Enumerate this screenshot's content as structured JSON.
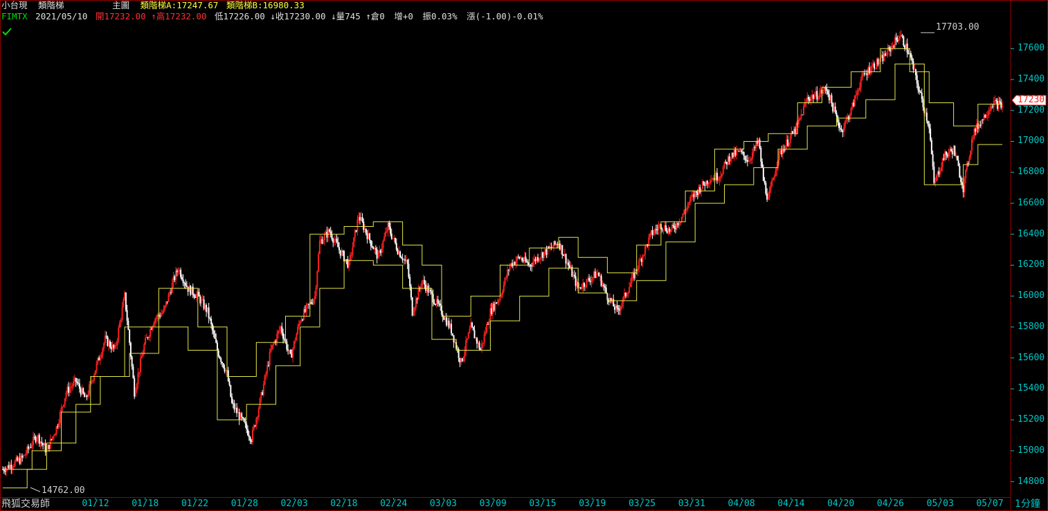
{
  "header": {
    "symbol_name": "小台現",
    "indicator_name": "類階梯",
    "pane_label": "主圖",
    "ladder_a_label": "類階梯A:",
    "ladder_a_value": "17247.67",
    "ladder_b_label": "類階梯B:",
    "ladder_b_value": "16980.33",
    "ticker": "FIMTX",
    "date": "2021/05/10",
    "open_label": "開",
    "open_value": "17232.00",
    "high_label": "高",
    "high_value": "17232.00",
    "low_label": "低",
    "low_value": "17226.00",
    "close_label": "收",
    "close_value": "17230.00",
    "volume_label": "量",
    "volume_value": "745",
    "oi_label": "倉",
    "oi_value": "0",
    "oi_change_label": "增",
    "oi_change_value": "+0",
    "amplitude_label": "振",
    "amplitude_value": "0.03%",
    "change_label": "漲",
    "change_value": "(-1.00)-0.01%",
    "arrow_up": "↑",
    "arrow_down": "↓"
  },
  "footer": {
    "brand": "飛狐交易師",
    "period": "1分鐘"
  },
  "colors": {
    "up": "#ff2020",
    "down": "#ffffff",
    "ladder": "#e8e84a",
    "axis_text": "#00c8c8",
    "border": "#9a0000",
    "header_yellow": "#ffff40",
    "header_green": "#00e000",
    "header_white": "#e0e0e0"
  },
  "chart_data": {
    "type": "candlestick",
    "x_ticks": [
      "01/12",
      "01/18",
      "01/22",
      "01/28",
      "02/03",
      "02/18",
      "02/24",
      "03/03",
      "03/09",
      "03/15",
      "03/19",
      "03/25",
      "03/31",
      "04/08",
      "04/14",
      "04/20",
      "04/26",
      "05/03",
      "05/07"
    ],
    "y_ticks": [
      14800,
      15000,
      15200,
      15400,
      15600,
      15800,
      16000,
      16200,
      16400,
      16600,
      16800,
      17000,
      17200,
      17400,
      17600
    ],
    "ylim": [
      14700,
      17780
    ],
    "last_price": "17230",
    "max_label": "17703.00",
    "min_label": "14762.00",
    "price_path": [
      [
        0,
        14880
      ],
      [
        4,
        14950
      ],
      [
        7,
        15100
      ],
      [
        9,
        15000
      ],
      [
        11,
        15150
      ],
      [
        13,
        15380
      ],
      [
        15,
        15450
      ],
      [
        17,
        15330
      ],
      [
        19,
        15530
      ],
      [
        21,
        15720
      ],
      [
        23,
        15650
      ],
      [
        25,
        16000
      ],
      [
        26,
        15700
      ],
      [
        27,
        15380
      ],
      [
        29,
        15680
      ],
      [
        31,
        15850
      ],
      [
        33,
        15900
      ],
      [
        35,
        16100
      ],
      [
        36,
        16180
      ],
      [
        38,
        16050
      ],
      [
        40,
        16000
      ],
      [
        42,
        15900
      ],
      [
        44,
        15650
      ],
      [
        46,
        15500
      ],
      [
        47,
        15300
      ],
      [
        49,
        15200
      ],
      [
        51,
        15080
      ],
      [
        53,
        15350
      ],
      [
        55,
        15650
      ],
      [
        57,
        15800
      ],
      [
        59,
        15600
      ],
      [
        61,
        15850
      ],
      [
        63,
        15950
      ],
      [
        64,
        16000
      ],
      [
        65,
        16350
      ],
      [
        67,
        16420
      ],
      [
        69,
        16300
      ],
      [
        71,
        16200
      ],
      [
        73,
        16520
      ],
      [
        75,
        16380
      ],
      [
        77,
        16250
      ],
      [
        79,
        16450
      ],
      [
        81,
        16300
      ],
      [
        83,
        16200
      ],
      [
        84,
        15900
      ],
      [
        86,
        16100
      ],
      [
        88,
        16000
      ],
      [
        90,
        15900
      ],
      [
        92,
        15780
      ],
      [
        94,
        15570
      ],
      [
        96,
        15800
      ],
      [
        98,
        15650
      ],
      [
        100,
        15900
      ],
      [
        102,
        16000
      ],
      [
        104,
        16200
      ],
      [
        106,
        16250
      ],
      [
        108,
        16200
      ],
      [
        110,
        16260
      ],
      [
        112,
        16300
      ],
      [
        114,
        16350
      ],
      [
        116,
        16200
      ],
      [
        118,
        16050
      ],
      [
        120,
        16100
      ],
      [
        122,
        16150
      ],
      [
        124,
        16000
      ],
      [
        126,
        15900
      ],
      [
        127,
        15960
      ],
      [
        129,
        16100
      ],
      [
        131,
        16250
      ],
      [
        133,
        16400
      ],
      [
        135,
        16460
      ],
      [
        137,
        16420
      ],
      [
        139,
        16500
      ],
      [
        141,
        16620
      ],
      [
        143,
        16700
      ],
      [
        145,
        16760
      ],
      [
        147,
        16780
      ],
      [
        149,
        16900
      ],
      [
        151,
        16930
      ],
      [
        153,
        16880
      ],
      [
        155,
        17000
      ],
      [
        156,
        16750
      ],
      [
        157,
        16620
      ],
      [
        159,
        16900
      ],
      [
        161,
        17000
      ],
      [
        163,
        17100
      ],
      [
        165,
        17280
      ],
      [
        167,
        17300
      ],
      [
        169,
        17340
      ],
      [
        171,
        17150
      ],
      [
        172,
        17070
      ],
      [
        174,
        17200
      ],
      [
        176,
        17400
      ],
      [
        178,
        17480
      ],
      [
        180,
        17520
      ],
      [
        182,
        17600
      ],
      [
        184,
        17690
      ],
      [
        186,
        17560
      ],
      [
        188,
        17320
      ],
      [
        190,
        17100
      ],
      [
        191,
        16720
      ],
      [
        193,
        16900
      ],
      [
        195,
        16950
      ],
      [
        197,
        16700
      ],
      [
        199,
        17050
      ],
      [
        201,
        17150
      ],
      [
        203,
        17250
      ],
      [
        205,
        17230
      ]
    ],
    "ladder_a": [
      [
        0,
        14880
      ],
      [
        6,
        14880
      ],
      [
        6,
        15000
      ],
      [
        12,
        15000
      ],
      [
        12,
        15250
      ],
      [
        18,
        15250
      ],
      [
        18,
        15480
      ],
      [
        25,
        15480
      ],
      [
        25,
        15800
      ],
      [
        32,
        15800
      ],
      [
        32,
        16050
      ],
      [
        40,
        16050
      ],
      [
        40,
        15800
      ],
      [
        46,
        15800
      ],
      [
        46,
        15480
      ],
      [
        52,
        15480
      ],
      [
        52,
        15700
      ],
      [
        58,
        15700
      ],
      [
        58,
        15870
      ],
      [
        63,
        15870
      ],
      [
        63,
        16400
      ],
      [
        70,
        16400
      ],
      [
        70,
        16450
      ],
      [
        76,
        16450
      ],
      [
        76,
        16480
      ],
      [
        82,
        16480
      ],
      [
        82,
        16330
      ],
      [
        86,
        16330
      ],
      [
        86,
        16200
      ],
      [
        90,
        16200
      ],
      [
        90,
        15870
      ],
      [
        96,
        15870
      ],
      [
        96,
        16000
      ],
      [
        102,
        16000
      ],
      [
        102,
        16200
      ],
      [
        108,
        16200
      ],
      [
        108,
        16310
      ],
      [
        114,
        16310
      ],
      [
        114,
        16380
      ],
      [
        118,
        16380
      ],
      [
        118,
        16250
      ],
      [
        124,
        16250
      ],
      [
        124,
        16150
      ],
      [
        130,
        16150
      ],
      [
        130,
        16330
      ],
      [
        135,
        16330
      ],
      [
        135,
        16480
      ],
      [
        140,
        16480
      ],
      [
        140,
        16680
      ],
      [
        146,
        16680
      ],
      [
        146,
        16950
      ],
      [
        152,
        16950
      ],
      [
        152,
        17000
      ],
      [
        157,
        17000
      ],
      [
        157,
        17050
      ],
      [
        163,
        17050
      ],
      [
        163,
        17250
      ],
      [
        168,
        17250
      ],
      [
        168,
        17350
      ],
      [
        174,
        17350
      ],
      [
        174,
        17450
      ],
      [
        180,
        17450
      ],
      [
        180,
        17600
      ],
      [
        186,
        17600
      ],
      [
        186,
        17450
      ],
      [
        190,
        17450
      ],
      [
        190,
        17250
      ],
      [
        195,
        17250
      ],
      [
        195,
        17100
      ],
      [
        200,
        17100
      ],
      [
        200,
        17240
      ],
      [
        205,
        17240
      ]
    ],
    "ladder_b": [
      [
        0,
        14760
      ],
      [
        5,
        14760
      ],
      [
        5,
        14880
      ],
      [
        9,
        14880
      ],
      [
        9,
        15050
      ],
      [
        15,
        15050
      ],
      [
        15,
        15300
      ],
      [
        20,
        15300
      ],
      [
        20,
        15480
      ],
      [
        26,
        15480
      ],
      [
        26,
        15630
      ],
      [
        32,
        15630
      ],
      [
        32,
        15800
      ],
      [
        38,
        15800
      ],
      [
        38,
        15650
      ],
      [
        44,
        15650
      ],
      [
        44,
        15200
      ],
      [
        50,
        15200
      ],
      [
        50,
        15300
      ],
      [
        56,
        15300
      ],
      [
        56,
        15550
      ],
      [
        61,
        15550
      ],
      [
        61,
        15800
      ],
      [
        65,
        15800
      ],
      [
        65,
        16050
      ],
      [
        70,
        16050
      ],
      [
        70,
        16230
      ],
      [
        76,
        16230
      ],
      [
        76,
        16200
      ],
      [
        82,
        16200
      ],
      [
        82,
        16050
      ],
      [
        88,
        16050
      ],
      [
        88,
        15720
      ],
      [
        93,
        15720
      ],
      [
        93,
        15650
      ],
      [
        100,
        15650
      ],
      [
        100,
        15840
      ],
      [
        106,
        15840
      ],
      [
        106,
        16000
      ],
      [
        112,
        16000
      ],
      [
        112,
        16180
      ],
      [
        118,
        16180
      ],
      [
        118,
        16020
      ],
      [
        124,
        16020
      ],
      [
        124,
        15970
      ],
      [
        130,
        15970
      ],
      [
        130,
        16100
      ],
      [
        136,
        16100
      ],
      [
        136,
        16350
      ],
      [
        142,
        16350
      ],
      [
        142,
        16600
      ],
      [
        148,
        16600
      ],
      [
        148,
        16720
      ],
      [
        154,
        16720
      ],
      [
        154,
        16830
      ],
      [
        159,
        16830
      ],
      [
        159,
        16950
      ],
      [
        165,
        16950
      ],
      [
        165,
        17100
      ],
      [
        171,
        17100
      ],
      [
        171,
        17150
      ],
      [
        177,
        17150
      ],
      [
        177,
        17270
      ],
      [
        183,
        17270
      ],
      [
        183,
        17500
      ],
      [
        189,
        17500
      ],
      [
        189,
        16720
      ],
      [
        197,
        16720
      ],
      [
        197,
        16850
      ],
      [
        200,
        16850
      ],
      [
        200,
        16980
      ],
      [
        205,
        16980
      ]
    ]
  }
}
